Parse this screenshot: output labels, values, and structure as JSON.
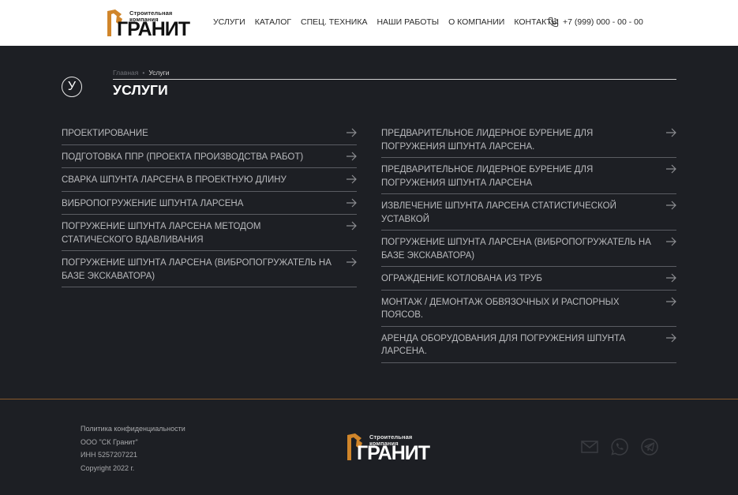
{
  "header": {
    "logo": {
      "small_line1": "Строительная",
      "small_line2": "компания",
      "big": "ГРАНИТ"
    },
    "nav": [
      "УСЛУГИ",
      "КАТАЛОГ",
      "СПЕЦ. ТЕХНИКА",
      "НАШИ РАБОТЫ",
      "О КОМПАНИИ",
      "КОНТАКТЫ"
    ],
    "phone": "+7 (999) 000 - 00 - 00"
  },
  "page": {
    "letter": "У",
    "breadcrumb": {
      "home": "Главная",
      "separator": "•",
      "current": "Услуги"
    },
    "title": "УСЛУГИ"
  },
  "services": {
    "left": [
      "ПРОЕКТИРОВАНИЕ",
      "ПОДГОТОВКА ППР (ПРОЕКТА ПРОИЗВОДСТВА РАБОТ)",
      "СВАРКА ШПУНТА ЛАРСЕНА В ПРОЕКТНУЮ ДЛИНУ",
      "ВИБРОПОГРУЖЕНИЕ ШПУНТА ЛАРСЕНА",
      "ПОГРУЖЕНИЕ ШПУНТА ЛАРСЕНА МЕТОДОМ СТАТИЧЕСКОГО ВДАВЛИВАНИЯ",
      "ПОГРУЖЕНИЕ ШПУНТА ЛАРСЕНА (ВИБРОПОГРУЖАТЕЛЬ НА БАЗЕ ЭКСКАВАТОРА)"
    ],
    "right": [
      "ПРЕДВАРИТЕЛЬНОЕ ЛИДЕРНОЕ БУРЕНИЕ ДЛЯ ПОГРУЖЕНИЯ ШПУНТА ЛАРСЕНА.",
      "ПРЕДВАРИТЕЛЬНОЕ ЛИДЕРНОЕ БУРЕНИЕ ДЛЯ ПОГРУЖЕНИЯ ШПУНТА ЛАРСЕНА",
      "ИЗВЛЕЧЕНИЕ ШПУНТА ЛАРСЕНА СТАТИСТИЧЕСКОЙ УСТАВКОЙ",
      "ПОГРУЖЕНИЕ ШПУНТА ЛАРСЕНА (ВИБРОПОГРУЖАТЕЛЬ НА БАЗЕ ЭКСКАВАТОРА)",
      "ОГРАЖДЕНИЕ КОТЛОВАНА ИЗ ТРУБ",
      "МОНТАЖ / ДЕМОНТАЖ ОБВЯЗОЧНЫХ И РАСПОРНЫХ ПОЯСОВ.",
      "АРЕНДА ОБОРУДОВАНИЯ ДЛЯ ПОГРУЖЕНИЯ ШПУНТА ЛАРСЕНА."
    ]
  },
  "footer": {
    "privacy": "Политика конфиденциальности",
    "company": "ООО \"СК Гранит\"",
    "inn": "ИНН 5257207221",
    "copyright": "Copyright 2022 г.",
    "socials": [
      "mail-icon",
      "whatsapp-icon",
      "telegram-icon"
    ]
  },
  "colors": {
    "background": "#1d1f24",
    "header": "#ffffff",
    "accent": "#d0852a",
    "divider": "#8a5a2b"
  }
}
